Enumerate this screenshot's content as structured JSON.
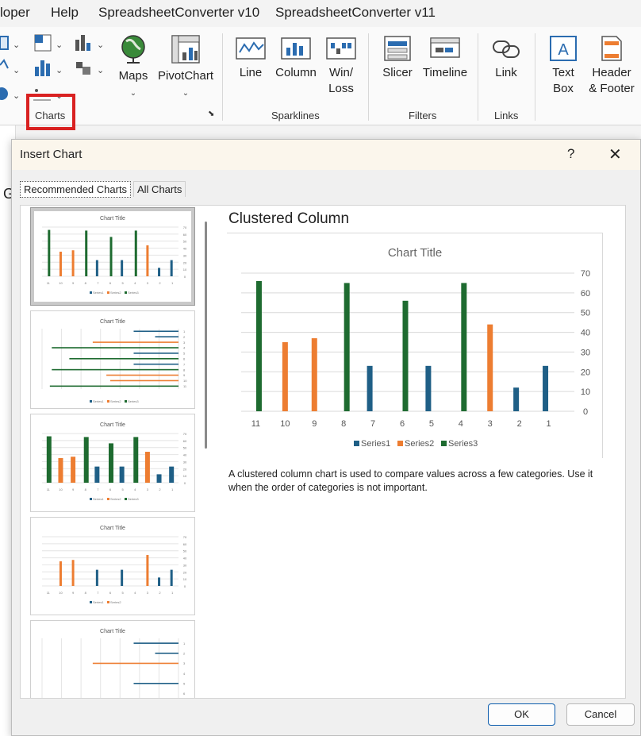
{
  "menu": [
    "loper",
    "Help",
    "SpreadsheetConverter v10",
    "SpreadsheetConverter v11"
  ],
  "ribbon": {
    "maps": "Maps",
    "pivotchart": "PivotChart",
    "line": "Line",
    "column": "Column",
    "winloss_1": "Win/",
    "winloss_2": "Loss",
    "slicer": "Slicer",
    "timeline": "Timeline",
    "link": "Link",
    "textbox_1": "Text",
    "textbox_2": "Box",
    "header_1": "Header",
    "header_2": "& Footer",
    "groups": {
      "charts": "Charts",
      "sparklines": "Sparklines",
      "filters": "Filters",
      "links": "Links"
    }
  },
  "sheet_cell": "G",
  "dialog": {
    "title": "Insert Chart",
    "help": "?",
    "close": "✕",
    "tabs": {
      "recommended": "Recommended Charts",
      "all": "All Charts"
    },
    "preview_title": "Clustered Column",
    "description": "A clustered column chart is used to compare values across a few categories. Use it when the order of categories is not important.",
    "ok": "OK",
    "cancel": "Cancel",
    "thumb_title": "Chart Title"
  },
  "chart_data": {
    "type": "bar",
    "title": "Chart Title",
    "categories": [
      "11",
      "10",
      "9",
      "8",
      "7",
      "6",
      "5",
      "4",
      "3",
      "2",
      "1"
    ],
    "series": [
      {
        "name": "Series1",
        "color": "#1f5f86",
        "values": [
          0,
          0,
          0,
          0,
          23,
          0,
          23,
          0,
          0,
          12,
          23
        ]
      },
      {
        "name": "Series2",
        "color": "#ed7d31",
        "values": [
          0,
          35,
          37,
          0,
          0,
          0,
          0,
          0,
          44,
          0,
          0
        ]
      },
      {
        "name": "Series3",
        "color": "#1e6b30",
        "values": [
          66,
          0,
          0,
          65,
          0,
          56,
          0,
          65,
          0,
          0,
          0
        ]
      }
    ],
    "yaxis_side": "right",
    "ylim": [
      0,
      70
    ],
    "yticks": [
      0,
      10,
      20,
      30,
      40,
      50,
      60,
      70
    ],
    "grid": true,
    "legend": "bottom"
  },
  "colors": {
    "accent_red": "#d92121",
    "series1": "#1f5f86",
    "series2": "#ed7d31",
    "series3": "#1e6b30"
  }
}
